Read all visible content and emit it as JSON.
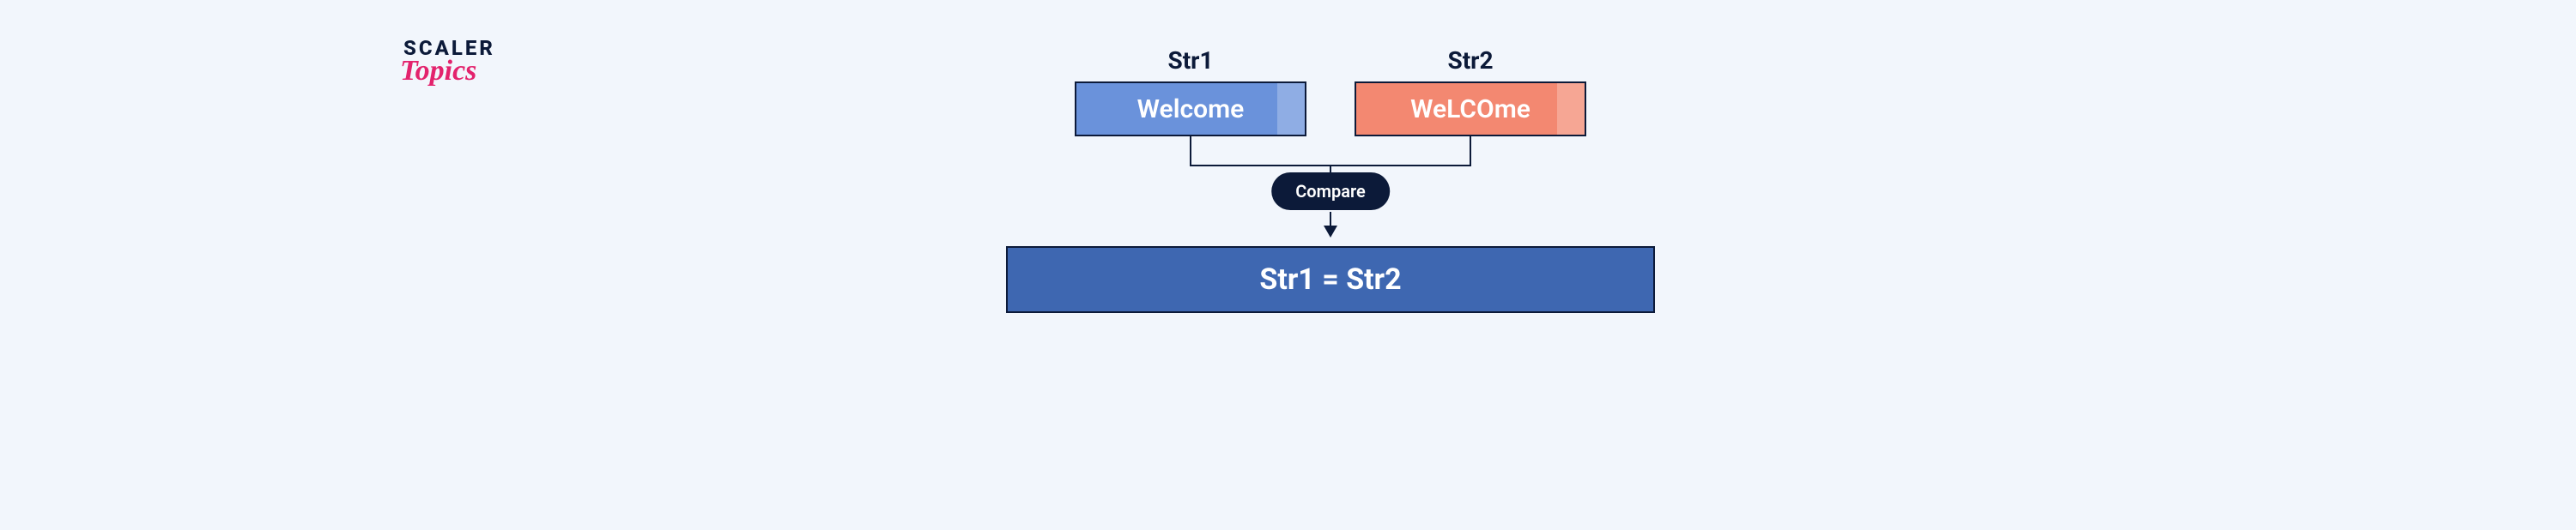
{
  "logo": {
    "line1": "SCALER",
    "line2": "Topics"
  },
  "diagram": {
    "str1_label": "Str1",
    "str2_label": "Str2",
    "str1_value": "Welcome",
    "str2_value": "WeLCOme",
    "compare_label": "Compare",
    "result_text": "Str1 = Str2",
    "colors": {
      "str1_box": "#6a92db",
      "str2_box": "#f38871",
      "result_box": "#3e67b1",
      "border": "#0c1a39",
      "pill_bg": "#0c1a39"
    }
  }
}
